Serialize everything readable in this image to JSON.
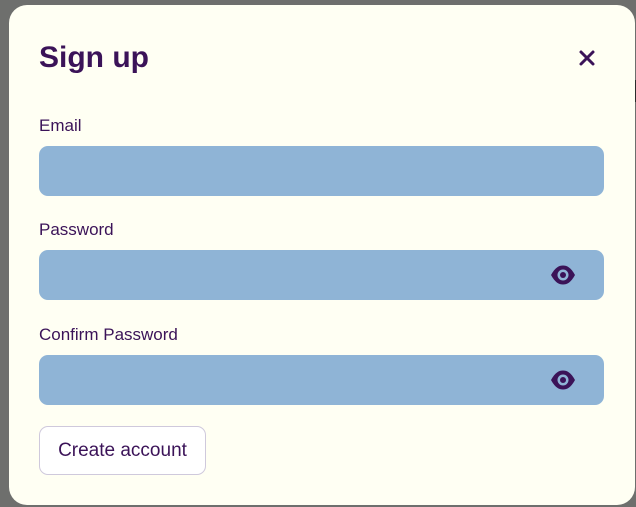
{
  "dialog": {
    "title": "Sign up",
    "close_icon": "close-icon"
  },
  "form": {
    "email": {
      "label": "Email",
      "value": "",
      "placeholder": ""
    },
    "password": {
      "label": "Password",
      "value": "",
      "placeholder": "",
      "icon": "eye-icon"
    },
    "confirm_password": {
      "label": "Confirm Password",
      "value": "",
      "placeholder": "",
      "icon": "eye-icon"
    },
    "submit_label": "Create account"
  },
  "colors": {
    "backdrop": "#6e6f6d",
    "modal_background": "#fffff3",
    "text": "#3b1358",
    "field_background": "#8fb4d6",
    "button_border": "#cfc9dc"
  }
}
